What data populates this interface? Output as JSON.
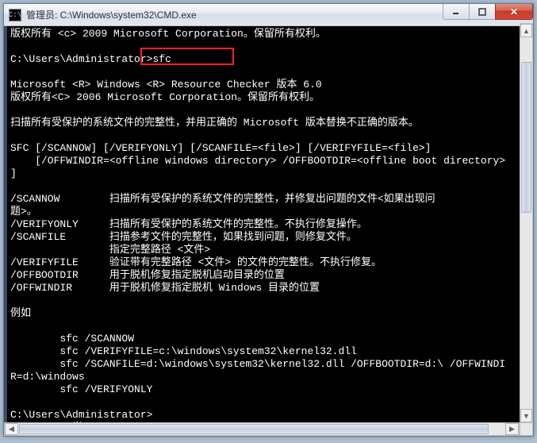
{
  "window": {
    "icon_text": "C:\\",
    "title": "管理员: C:\\Windows\\system32\\CMD.exe"
  },
  "term": {
    "l0": "版权所有 <c> 2009 Microsoft Corporation。保留所有权利。",
    "l1": "",
    "l2": "C:\\Users\\Administrator>sfc",
    "l3": "",
    "l4": "Microsoft <R> Windows <R> Resource Checker 版本 6.0",
    "l5": "版权所有<C> 2006 Microsoft Corporation。保留所有权利。",
    "l6": "",
    "l7": "扫描所有受保护的系统文件的完整性，并用正确的 Microsoft 版本替换不正确的版本。",
    "l8": "",
    "l9": "SFC [/SCANNOW] [/VERIFYONLY] [/SCANFILE=<file>] [/VERIFYFILE=<file>]",
    "l10": "    [/OFFWINDIR=<offline windows directory> /OFFBOOTDIR=<offline boot directory>",
    "l11": "]",
    "l12": "",
    "l13": "/SCANNOW        扫描所有受保护的系统文件的完整性，并修复出问题的文件<如果出现问",
    "l14": "题>。",
    "l15": "/VERIFYONLY     扫描所有受保护的系统文件的完整性。不执行修复操作。",
    "l16": "/SCANFILE       扫描参考文件的完整性，如果找到问题，则修复文件。",
    "l17": "                指定完整路径 <文件>",
    "l18": "/VERIFYFILE     验证带有完整路径 <文件> 的文件的完整性。不执行修复。",
    "l19": "/OFFBOOTDIR     用于脱机修复指定脱机启动目录的位置",
    "l20": "/OFFWINDIR      用于脱机修复指定脱机 Windows 目录的位置",
    "l21": "",
    "l22": "例如",
    "l23": "",
    "l24": "        sfc /SCANNOW",
    "l25": "        sfc /VERIFYFILE=c:\\windows\\system32\\kernel32.dll",
    "l26": "        sfc /SCANFILE=d:\\windows\\system32\\kernel32.dll /OFFBOOTDIR=d:\\ /OFFWINDI",
    "l27": "R=d:\\windows",
    "l28": "        sfc /VERIFYONLY",
    "l29": "",
    "l30": "C:\\Users\\Administrator>",
    "l31": "          半:"
  }
}
